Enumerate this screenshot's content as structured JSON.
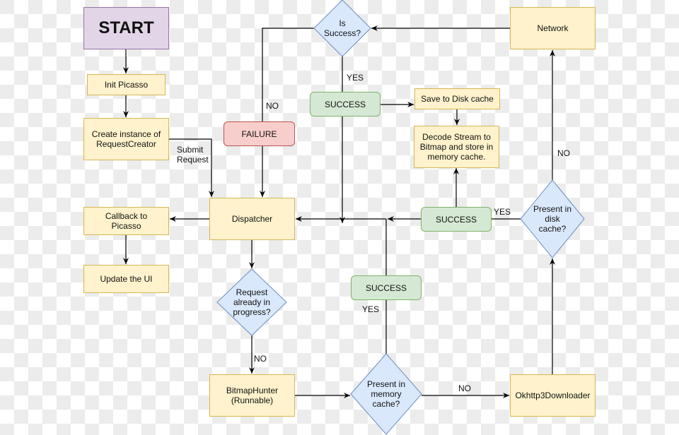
{
  "diagram": {
    "nodes": {
      "start": "START",
      "init_picasso": "Init Picasso",
      "create_instance": "Create instance of\nRequestCreator",
      "callback": "Callback to\nPicasso",
      "update_ui": "Update the UI",
      "dispatcher": "Dispatcher",
      "request_in_progress": "Request\nalready in\nprogress?",
      "bitmap_hunter": "BitmapHunter\n(Runnable)",
      "present_memory": "Present in\nmemory\ncache?",
      "okhttp": "Okhttp3Downloader",
      "present_disk": "Present in\ndisk\ncache?",
      "network": "Network",
      "is_success": "Is\nSuccess?",
      "success_top": "SUCCESS",
      "failure": "FAILURE",
      "save_disk": "Save to Disk cache",
      "decode_stream": "Decode Stream to\nBitmap and store in\nmemory cache.",
      "success_mid": "SUCCESS",
      "success_low": "SUCCESS"
    },
    "edge_labels": {
      "submit_request": "Submit\nRequest",
      "is_success_no": "NO",
      "is_success_yes": "YES",
      "disk_no": "NO",
      "disk_yes": "YES",
      "memory_yes": "YES",
      "memory_no": "NO",
      "progress_no": "NO"
    },
    "colors": {
      "process_fill": "#fff2cc",
      "process_stroke": "#d6b656",
      "start_fill": "#e1d5e7",
      "start_stroke": "#9673a6",
      "decision_fill": "#dae8fc",
      "decision_stroke": "#6c8ebf",
      "success_fill": "#d5e8d4",
      "success_stroke": "#82b366",
      "failure_fill": "#f8cecc",
      "failure_stroke": "#b85450"
    }
  }
}
